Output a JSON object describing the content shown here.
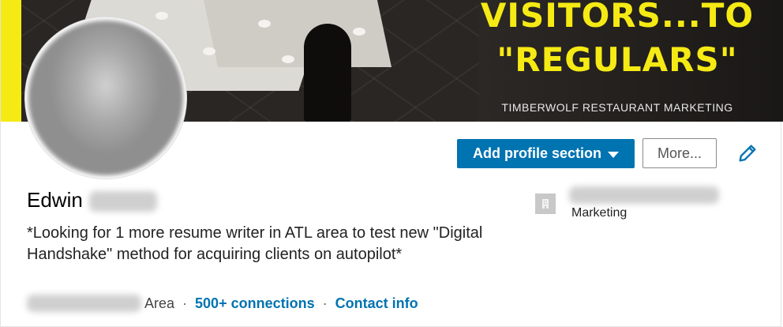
{
  "banner": {
    "headline_line1": "VISITORS...TO",
    "headline_line2": "\"REGULARS\"",
    "brand": "TIMBERWOLF RESTAURANT MARKETING",
    "accent_color": "#f5ea14"
  },
  "avatar": {
    "icon": "profile-photo-blurred"
  },
  "actions": {
    "add_section_label": "Add profile section",
    "add_section_icon": "caret-down-icon",
    "more_label": "More...",
    "edit_icon": "pencil-icon",
    "primary_color": "#0073b1"
  },
  "profile": {
    "first_name": "Edwin",
    "headline": "*Looking for 1 more resume writer in ATL area to test new \"Digital Handshake\" method for acquiring clients on autopilot*",
    "location_suffix": "Area",
    "connections": "500+ connections",
    "contact_info": "Contact info",
    "separator": "·"
  },
  "company": {
    "logo_icon": "building-icon",
    "role": "Marketing"
  }
}
